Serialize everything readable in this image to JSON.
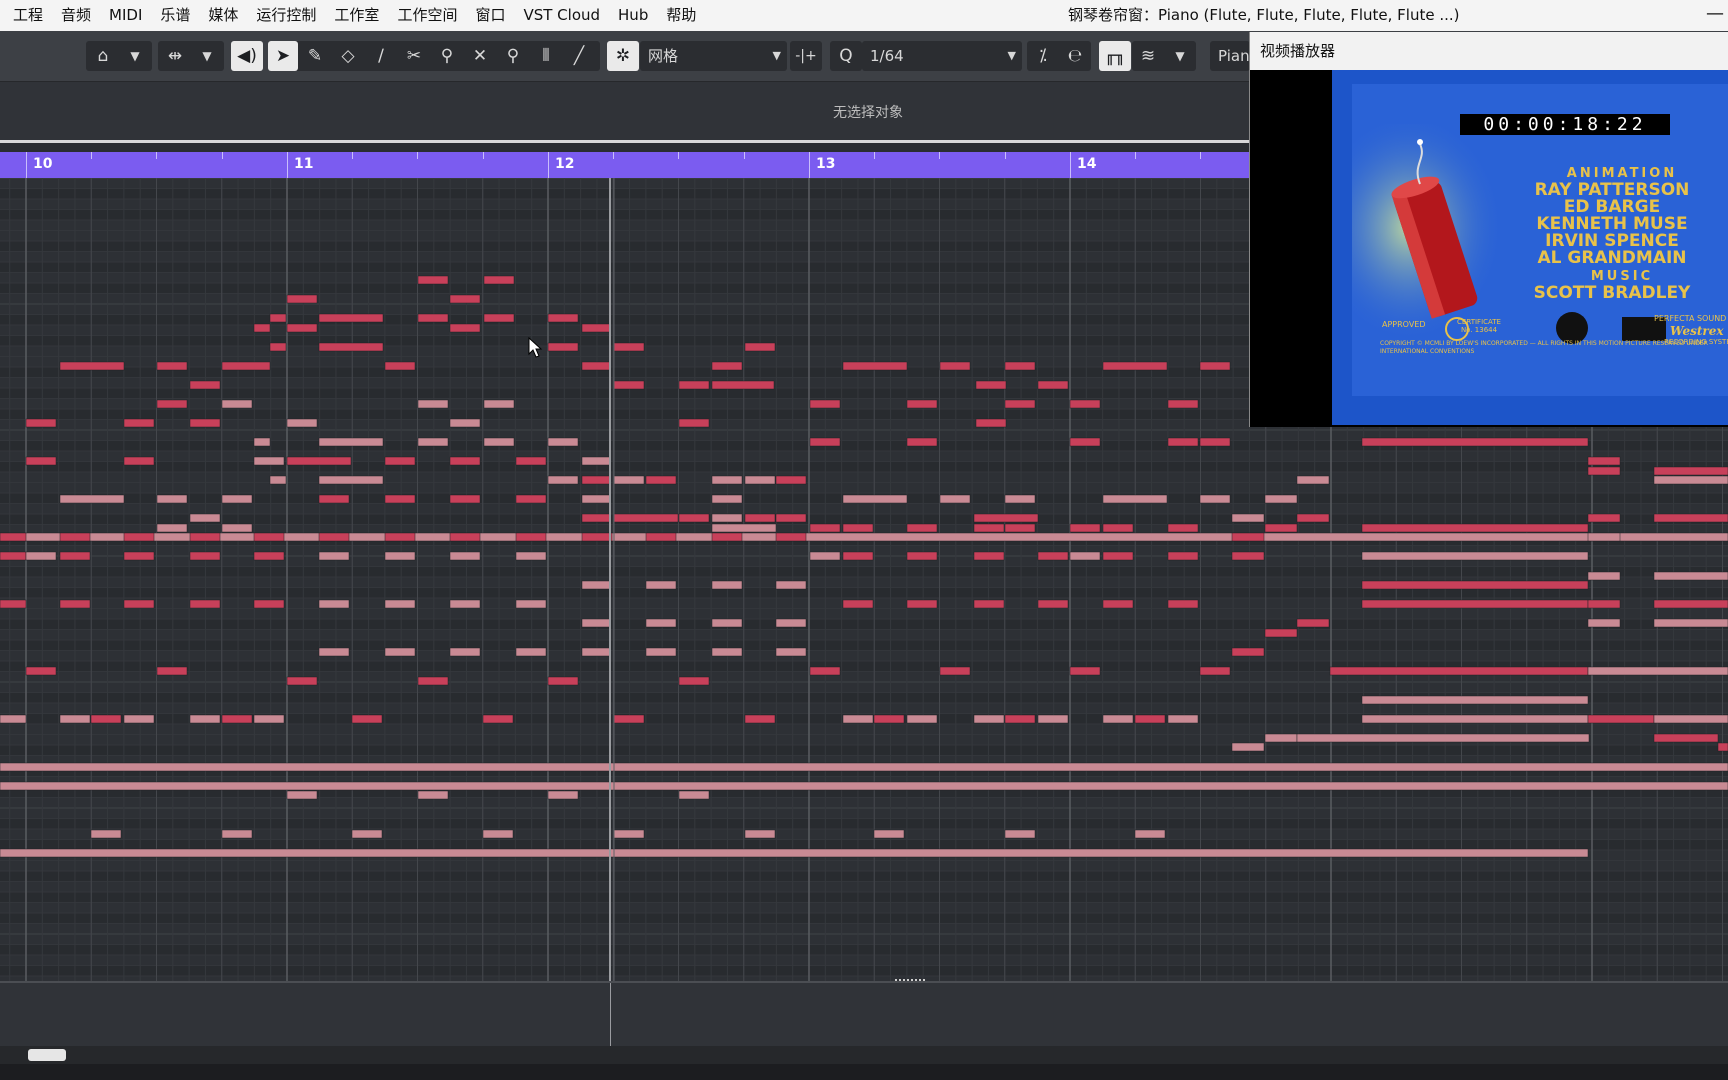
{
  "menubar": {
    "items": [
      "工程",
      "音频",
      "MIDI",
      "乐谱",
      "媒体",
      "运行控制",
      "工作室",
      "工作空间",
      "窗口",
      "VST Cloud",
      "Hub",
      "帮助"
    ],
    "window_title": "钢琴卷帘窗：Piano (Flute, Flute, Flute, Flute, Flute ...)",
    "minimize": "—"
  },
  "toolbar": {
    "grid_type": "网格",
    "quantize": "1/64",
    "quantize_icon": "Q",
    "track_name": "Pian",
    "icons": [
      "monitor-icon",
      "dropdown-icon",
      "snap-icon",
      "dropdown-icon",
      "speaker-icon",
      "pointer-icon",
      "pencil-icon",
      "eraser-icon",
      "pen-icon",
      "scissors-icon",
      "glue-icon",
      "mute-icon",
      "zoom-icon",
      "velocity-icon",
      "line-icon",
      "grid-snap-icon",
      "insert-icon",
      "swing-icon",
      "iterative-icon",
      "chord-icon",
      "layers-icon"
    ]
  },
  "info": {
    "text": "无选择对象"
  },
  "ruler": {
    "bars": [
      "10",
      "11",
      "12",
      "13",
      "14"
    ]
  },
  "video_player": {
    "title": "视频播放器",
    "timecode": "00:00:18:22",
    "credits": {
      "heading": "ANIMATION",
      "names": [
        "RAY PATTERSON",
        "ED BARGE",
        "KENNETH MUSE",
        "IRVIN SPENCE",
        "AL GRANDMAIN"
      ],
      "music_heading": "MUSIC",
      "music_name": "SCOTT BRADLEY",
      "approved": "APPROVED",
      "certificate": "CERTIFICATE No. 13644",
      "perfecta": "PERFECTA SOUND",
      "westrex": "Westrex",
      "recording": "RECORDING SYSTEM",
      "copyright": "COPYRIGHT © MCMLI BY LOEW'S INCORPORATED — ALL RIGHTS IN THIS MOTION PICTURE RESERVED UNDER INTERNATIONAL CONVENTIONS"
    }
  },
  "colors": {
    "ruler": "#7b5cf0",
    "note_red": "#c8405a",
    "note_pink": "#c98a94",
    "video_blue": "#1d55c9",
    "credit_gold": "#e8c24a"
  }
}
